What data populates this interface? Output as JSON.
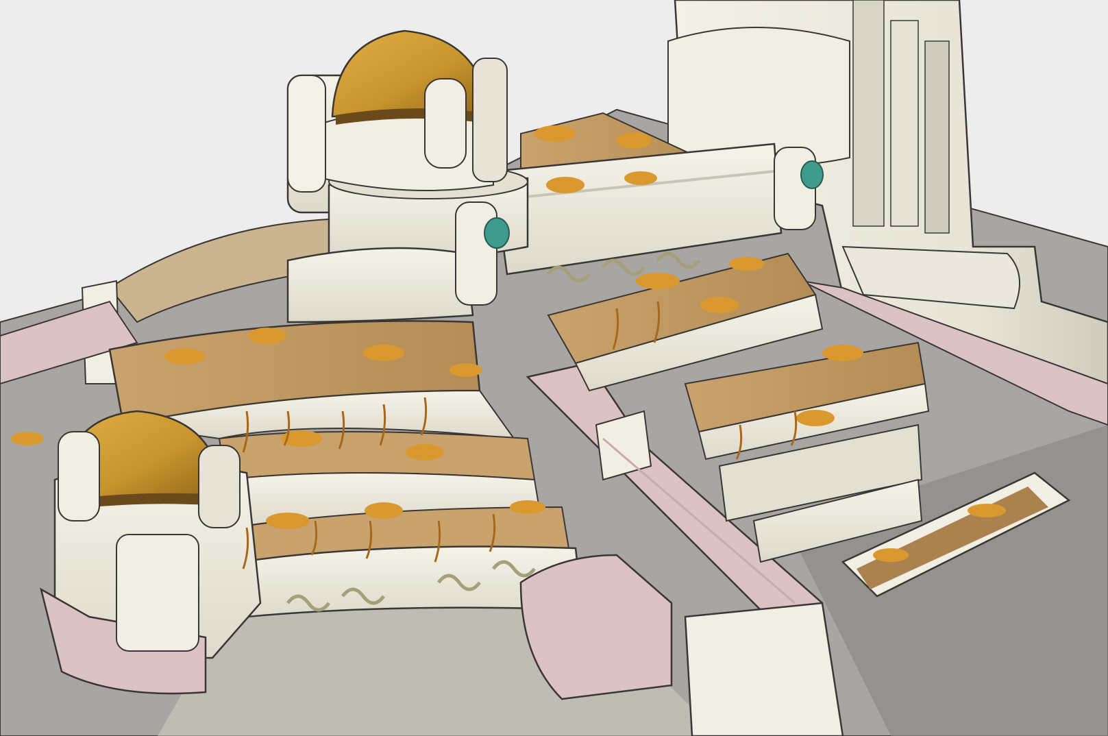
{
  "artwork": {
    "kind": "concept-art-illustration",
    "palette": {
      "background": "#ededee",
      "ground": "#a7a6a3",
      "ground_dark": "#8b8a87",
      "stone_light": "#f3f0e6",
      "stone_mid": "#e3dfd1",
      "stone_shadow": "#c9c5b6",
      "walkway_pink": "#dcc3c3",
      "walkway_pink_dark": "#c9abab",
      "terrace_soil": "#c7a06a",
      "terrace_soil_dark": "#a9824e",
      "foliage_orange": "#d9992e",
      "foliage_dark": "#a8681c",
      "dome_gold": "#c9962e",
      "dome_gold_dark": "#8f6418",
      "dome_band": "#6a4a1a",
      "gem_teal": "#3f9c8c",
      "ornament_olive": "#a5a07a",
      "outline": "#3a3633"
    },
    "icons": [
      "dome-gold",
      "teal-gem-ornament",
      "woven-knot-ornament",
      "autumn-foliage-clump"
    ]
  }
}
